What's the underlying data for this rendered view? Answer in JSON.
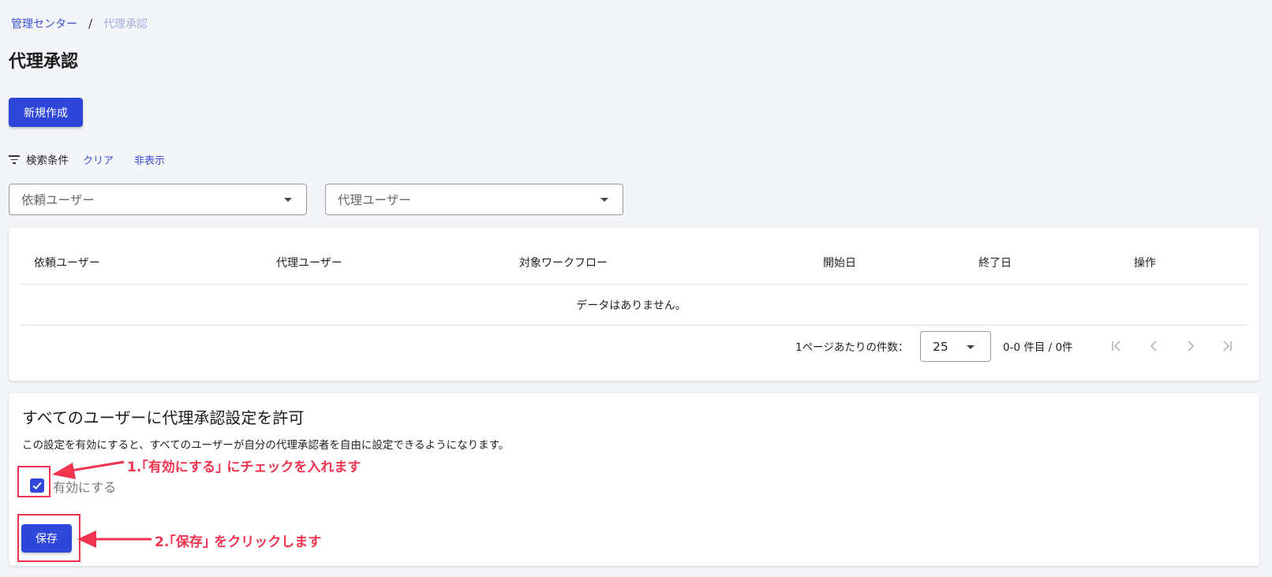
{
  "breadcrumb": {
    "root": "管理センター",
    "separator": "/",
    "current": "代理承認"
  },
  "page_title": "代理承認",
  "new_button_label": "新規作成",
  "filters": {
    "label": "検索条件",
    "clear": "クリア",
    "hide": "非表示",
    "requester_placeholder": "依頼ユーザー",
    "delegate_placeholder": "代理ユーザー"
  },
  "table": {
    "columns": [
      "依頼ユーザー",
      "代理ユーザー",
      "対象ワークフロー",
      "開始日",
      "終了日",
      "操作"
    ],
    "empty_message": "データはありません。",
    "per_page_label": "1ページあたりの件数：",
    "per_page_value": "25",
    "range_text": "0-0 件目 / 0件"
  },
  "settings": {
    "title": "すべてのユーザーに代理承認設定を許可",
    "description": "この設定を有効にすると、すべてのユーザーが自分の代理承認者を自由に設定できるようになります。",
    "enable_label": "有効にする",
    "enable_checked": true,
    "save_label": "保存"
  },
  "annotations": {
    "step1": "1.｢有効にする｣ にチェックを入れます",
    "step2": "2.｢保存｣ をクリックします"
  },
  "colors": {
    "accent": "#2f47d8",
    "link": "#3a50d0",
    "annotation": "#f0334f"
  }
}
